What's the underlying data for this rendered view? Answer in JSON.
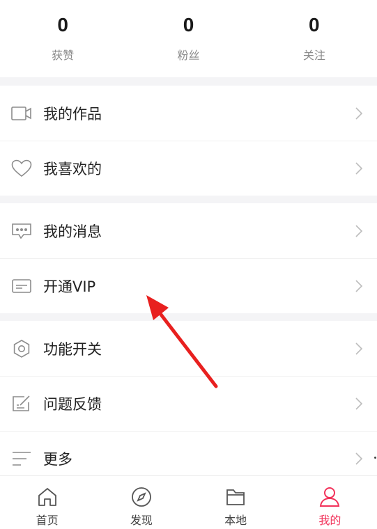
{
  "stats": [
    {
      "value": "0",
      "label": "获赞"
    },
    {
      "value": "0",
      "label": "粉丝"
    },
    {
      "value": "0",
      "label": "关注"
    }
  ],
  "menu": {
    "works": "我的作品",
    "likes": "我喜欢的",
    "messages": "我的消息",
    "vip": "开通VIP",
    "features": "功能开关",
    "feedback": "问题反馈",
    "more": "更多"
  },
  "tabs": [
    {
      "label": "首页"
    },
    {
      "label": "发现"
    },
    {
      "label": "本地"
    },
    {
      "label": "我的"
    }
  ],
  "colors": {
    "accent": "#f2325a",
    "annotation_arrow": "#e8201f"
  }
}
